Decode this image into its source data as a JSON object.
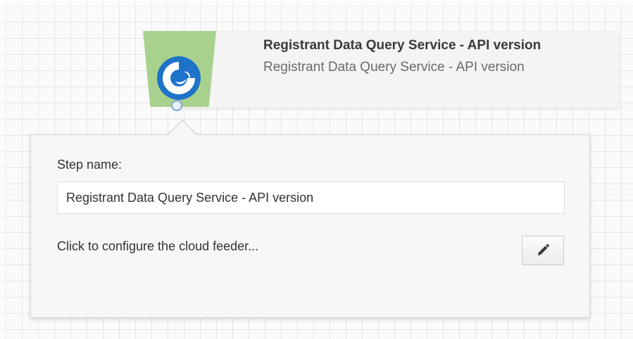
{
  "step": {
    "title": "Registrant Data Query Service - API version",
    "subtitle": "Registrant Data Query Service - API version",
    "icon": "cloud-feeder-logo-icon",
    "plate_color": "#a9d18e",
    "logo_color": "#1e73c9"
  },
  "config_panel": {
    "step_name_label": "Step name:",
    "step_name_value": "Registrant Data Query Service - API version",
    "configure_text": "Click to configure the cloud feeder...",
    "edit_icon": "pencil-icon"
  }
}
